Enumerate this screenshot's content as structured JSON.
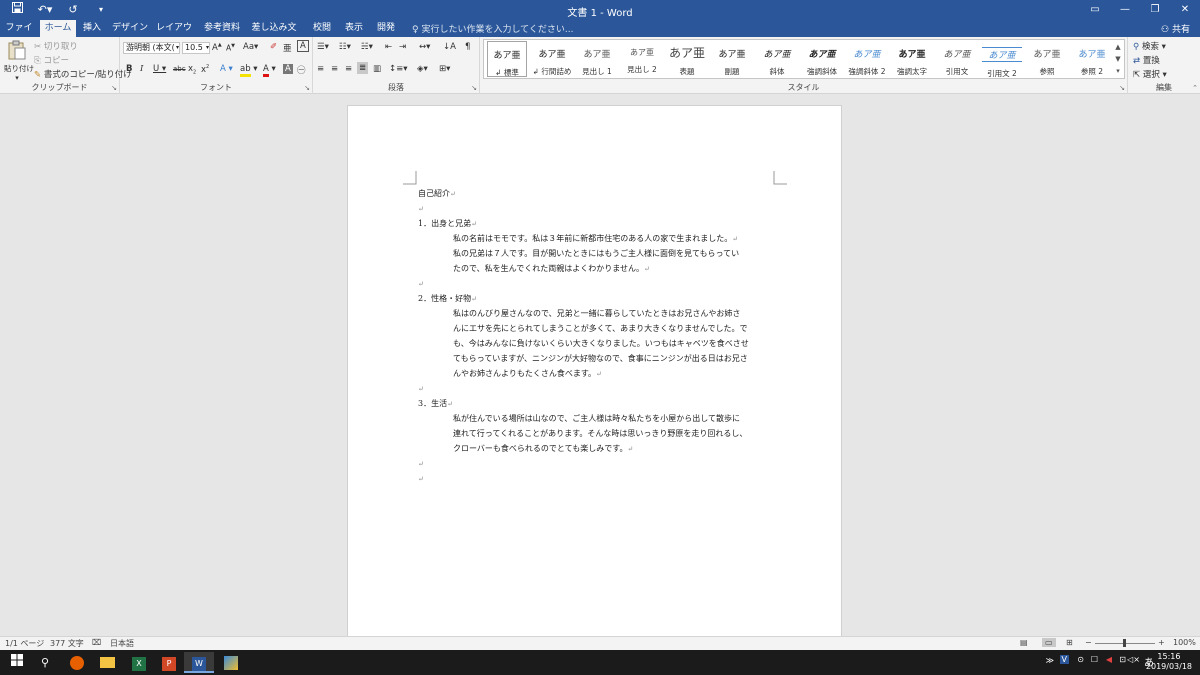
{
  "window": {
    "title": "文書 1 - Word",
    "controls": [
      "▭",
      "—",
      "❐",
      "✕"
    ]
  },
  "qat": {
    "save_icon": "save-icon",
    "undo_icon": "undo-icon",
    "redo_icon": "redo-icon",
    "customize_icon": "customize-icon"
  },
  "tabs": [
    "ファイル",
    "ホーム",
    "挿入",
    "デザイン",
    "レイアウト",
    "参考資料",
    "差し込み文書",
    "校閲",
    "表示",
    "開発"
  ],
  "active_tab": "ホーム",
  "tellme": "実行したい作業を入力してください...",
  "share": "共有",
  "ribbon": {
    "clipboard": {
      "label": "クリップボード",
      "paste": "貼り付け",
      "cut": "切り取り",
      "copy": "コピー",
      "format_painter": "書式のコピー/貼り付け"
    },
    "font": {
      "label": "フォント",
      "font_name": "游明朝 (本文(",
      "font_size": "10.5"
    },
    "paragraph": {
      "label": "段落"
    },
    "styles": {
      "label": "スタイル",
      "items": [
        {
          "sample": "あア亜",
          "name": "↲ 標準"
        },
        {
          "sample": "あア亜",
          "name": "↲ 行間詰め"
        },
        {
          "sample": "あア亜",
          "name": "見出し 1"
        },
        {
          "sample": "あア亜",
          "name": "見出し 2"
        },
        {
          "sample": "あア亜",
          "name": "表題"
        },
        {
          "sample": "あア亜",
          "name": "副題"
        },
        {
          "sample": "あア亜",
          "name": "斜体"
        },
        {
          "sample": "あア亜",
          "name": "強調斜体"
        },
        {
          "sample": "あア亜",
          "name": "強調斜体 2"
        },
        {
          "sample": "あア亜",
          "name": "強調太字"
        },
        {
          "sample": "あア亜",
          "name": "引用文"
        },
        {
          "sample": "あア亜",
          "name": "引用文 2"
        },
        {
          "sample": "あア亜",
          "name": "参照"
        },
        {
          "sample": "あア亜",
          "name": "参照 2"
        }
      ]
    },
    "editing": {
      "label": "編集",
      "find": "検索",
      "replace": "置換",
      "select": "選択"
    }
  },
  "document": {
    "lines": [
      {
        "text": "自己紹介",
        "indent": false
      },
      {
        "text": "",
        "indent": false
      },
      {
        "text": "1．出身と兄弟",
        "indent": false
      },
      {
        "text": "私の名前はモモです。私は３年前に新都市住宅のある人の家で生まれました。",
        "indent": true
      },
      {
        "text": "私の兄弟は７人です。目が開いたときにはもうご主人様に面倒を見てもらってい",
        "indent": true,
        "nomark": true
      },
      {
        "text": "たので、私を生んでくれた両親はよくわかりません。",
        "indent": true
      },
      {
        "text": "",
        "indent": false
      },
      {
        "text": "2．性格・好物",
        "indent": false
      },
      {
        "text": "私はのんびり屋さんなので、兄弟と一緒に暮らしていたときはお兄さんやお姉さ",
        "indent": true,
        "nomark": true
      },
      {
        "text": "んにエサを先にとられてしまうことが多くて、あまり大きくなりませんでした。で",
        "indent": true,
        "nomark": true
      },
      {
        "text": "も、今はみんなに負けないくらい大きくなりました。いつもはキャベツを食べさせ",
        "indent": true,
        "nomark": true
      },
      {
        "text": "てもらっていますが、ニンジンが大好物なので、食事にニンジンが出る日はお兄さ",
        "indent": true,
        "nomark": true
      },
      {
        "text": "んやお姉さんよりもたくさん食べます。",
        "indent": true
      },
      {
        "text": "",
        "indent": false
      },
      {
        "text": "3．生活",
        "indent": false
      },
      {
        "text": "私が住んでいる場所は山なので、ご主人様は時々私たちを小屋から出して散歩に",
        "indent": true,
        "nomark": true
      },
      {
        "text": "連れて行ってくれることがあります。そんな時は思いっきり野原を走り回れるし、",
        "indent": true,
        "nomark": true
      },
      {
        "text": "クローバーも食べられるのでとても楽しみです。",
        "indent": true
      },
      {
        "text": "",
        "indent": false
      },
      {
        "text": "",
        "indent": false
      }
    ],
    "para_mark": "↵"
  },
  "status": {
    "page": "1/1 ページ",
    "words": "377 文字",
    "language": "日本語",
    "zoom": "100%"
  },
  "taskbar": {
    "time": "15:16",
    "date": "2019/03/18",
    "ime": "あ"
  }
}
